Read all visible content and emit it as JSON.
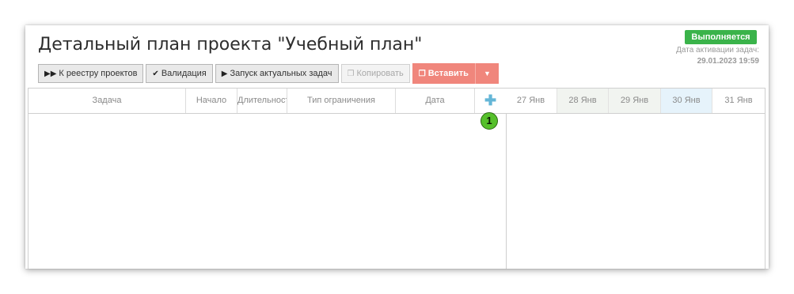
{
  "page": {
    "title": "Детальный план проекта \"Учебный план\""
  },
  "status": {
    "badge": "Выполняется",
    "badge_color": "#3ab34a",
    "activation_label": "Дата активации задач:",
    "activation_date": "29.01.2023 19:59"
  },
  "toolbar": {
    "registry_label": "К реестру проектов",
    "registry_icon": "fast-forward-icon",
    "validation_label": "Валидация",
    "validation_icon": "double-check-icon",
    "launch_label": "Запуск актуальных задач",
    "launch_icon": "play-icon",
    "copy_label": "Копировать",
    "copy_icon": "copy-icon",
    "paste_label": "Вставить",
    "paste_icon": "paste-icon",
    "paste_color": "#f0867c"
  },
  "grid": {
    "columns": [
      {
        "label": "Задача"
      },
      {
        "label": "Начало"
      },
      {
        "label": "Длительность"
      },
      {
        "label": "Тип ограничения"
      },
      {
        "label": "Дата"
      }
    ],
    "add_column_icon": "plus-icon",
    "add_column_color": "#64b6d7",
    "marker_label": "1",
    "marker_color": "#56c02b"
  },
  "timeline": {
    "days": [
      {
        "label": "27 Янв",
        "bg": "#ffffff"
      },
      {
        "label": "28 Янв",
        "bg": "#f1f4f0"
      },
      {
        "label": "29 Янв",
        "bg": "#f1f4f0"
      },
      {
        "label": "30 Янв",
        "bg": "#e6f3fb"
      },
      {
        "label": "31 Янв",
        "bg": "#ffffff"
      }
    ]
  }
}
